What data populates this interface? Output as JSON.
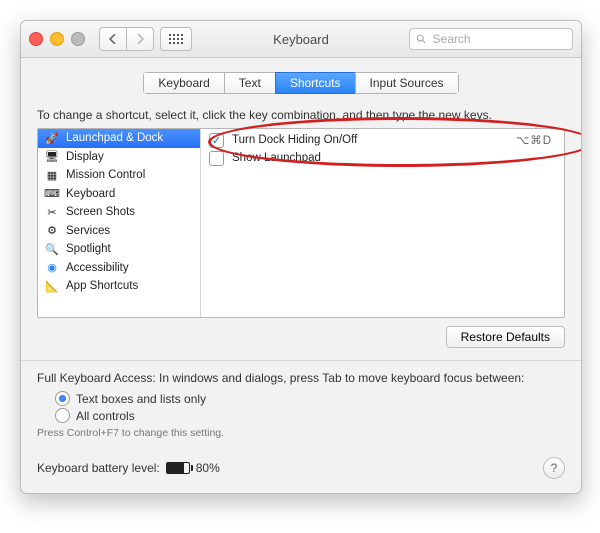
{
  "window": {
    "title": "Keyboard"
  },
  "search": {
    "placeholder": "Search"
  },
  "tabs": [
    {
      "label": "Keyboard"
    },
    {
      "label": "Text"
    },
    {
      "label": "Shortcuts"
    },
    {
      "label": "Input Sources"
    }
  ],
  "instruction": "To change a shortcut, select it, click the key combination, and then type the new keys.",
  "categories": [
    {
      "label": "Launchpad & Dock",
      "icon": "launchpad"
    },
    {
      "label": "Display",
      "icon": "display"
    },
    {
      "label": "Mission Control",
      "icon": "mission"
    },
    {
      "label": "Keyboard",
      "icon": "keyboard"
    },
    {
      "label": "Screen Shots",
      "icon": "screenshot"
    },
    {
      "label": "Services",
      "icon": "services"
    },
    {
      "label": "Spotlight",
      "icon": "spotlight"
    },
    {
      "label": "Accessibility",
      "icon": "accessibility"
    },
    {
      "label": "App Shortcuts",
      "icon": "appshortcuts"
    }
  ],
  "shortcuts": [
    {
      "checked": true,
      "label": "Turn Dock Hiding On/Off",
      "keys": "⌥⌘D"
    },
    {
      "checked": false,
      "label": "Show Launchpad",
      "keys": ""
    }
  ],
  "restore": "Restore Defaults",
  "fka": {
    "label": "Full Keyboard Access: In windows and dialogs, press Tab to move keyboard focus between:",
    "opt1": "Text boxes and lists only",
    "opt2": "All controls",
    "hint": "Press Control+F7 to change this setting."
  },
  "battery": {
    "label": "Keyboard battery level:",
    "percent": "80%"
  }
}
